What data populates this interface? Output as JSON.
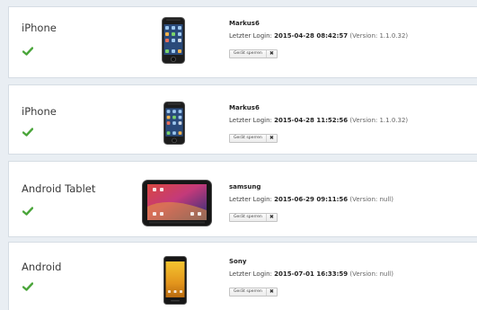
{
  "devices": [
    {
      "name": "iPhone",
      "status_icon": "checkmark-icon",
      "image_icon": "iphone-icon",
      "owner": "Markus6",
      "login_label": "Letzter Login:",
      "login_time": "2015-04-28 08:42:57",
      "version": "(Version: 1.1.0.32)",
      "lock_label": "Gerät sperren",
      "close_glyph": "✖"
    },
    {
      "name": "iPhone",
      "status_icon": "checkmark-icon",
      "image_icon": "iphone-icon",
      "owner": "Markus6",
      "login_label": "Letzter Login:",
      "login_time": "2015-04-28 11:52:56",
      "version": "(Version: 1.1.0.32)",
      "lock_label": "Gerät sperren",
      "close_glyph": "✖"
    },
    {
      "name": "Android Tablet",
      "status_icon": "checkmark-icon",
      "image_icon": "android-tablet-icon",
      "owner": "samsung",
      "login_label": "Letzter Login:",
      "login_time": "2015-06-29 09:11:56",
      "version": "(Version: null)",
      "lock_label": "Gerät sperren",
      "close_glyph": "✖"
    },
    {
      "name": "Android",
      "status_icon": "checkmark-icon",
      "image_icon": "android-phone-icon",
      "owner": "Sony",
      "login_label": "Letzter Login:",
      "login_time": "2015-07-01 16:33:59",
      "version": "(Version: null)",
      "lock_label": "Gerät sperren",
      "close_glyph": "✖"
    }
  ],
  "colors": {
    "check_green": "#4aa53a",
    "page_bg": "#e9eef3",
    "card_bg": "#ffffff"
  }
}
